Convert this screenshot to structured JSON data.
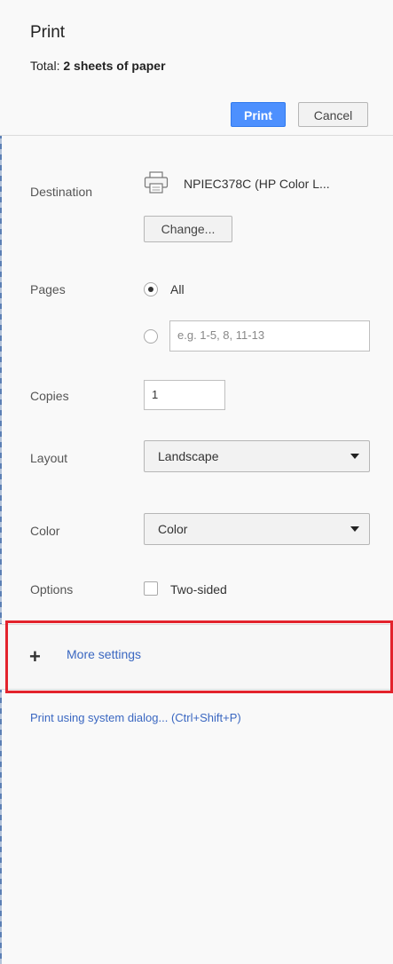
{
  "header": {
    "title": "Print",
    "total_label": "Total:",
    "total_value": "2 sheets of paper",
    "print_button": "Print",
    "cancel_button": "Cancel"
  },
  "destination": {
    "label": "Destination",
    "printer_name": "NPIEC378C (HP Color L...",
    "change_button": "Change...",
    "icon": "printer-icon"
  },
  "pages": {
    "label": "Pages",
    "options": [
      {
        "label": "All",
        "selected": true
      },
      {
        "label": "",
        "selected": false
      }
    ],
    "custom_placeholder": "e.g. 1-5, 8, 11-13"
  },
  "copies": {
    "label": "Copies",
    "value": "1"
  },
  "layout": {
    "label": "Layout",
    "selected": "Landscape"
  },
  "color": {
    "label": "Color",
    "selected": "Color"
  },
  "options": {
    "label": "Options",
    "two_sided_label": "Two-sided",
    "two_sided_checked": false
  },
  "more_settings": {
    "icon": "plus-icon",
    "label": "More settings",
    "highlight_color": "#e3232c"
  },
  "system_dialog_link": "Print using system dialog... (Ctrl+Shift+P)",
  "colors": {
    "accent": "#4d90fe",
    "link": "#3a67c1",
    "background": "#f9f9f9"
  }
}
